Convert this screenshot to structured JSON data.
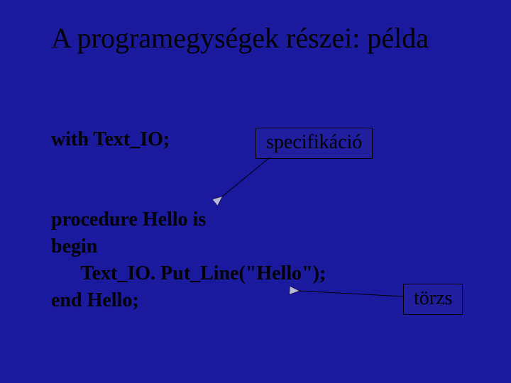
{
  "title": "A programegységek részei: példa",
  "code": {
    "line1": "with Text_IO;",
    "line2": "",
    "line3": "procedure Hello is",
    "line4": "begin",
    "line5": "      Text_IO. Put_Line(\"Hello\");",
    "line6": "end Hello;"
  },
  "labels": {
    "specification": "specifikáció",
    "body": "törzs"
  }
}
